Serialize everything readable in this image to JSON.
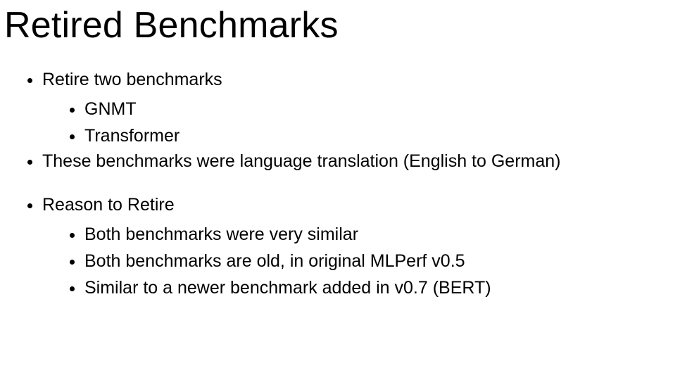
{
  "title": "Retired Benchmarks",
  "bullets": {
    "b1": "Retire two benchmarks",
    "b1_children": {
      "c1": "GNMT",
      "c2": "Transformer"
    },
    "b2": "These benchmarks were language translation (English to German)",
    "b3": "Reason to Retire",
    "b3_children": {
      "c1": "Both benchmarks were very similar",
      "c2": "Both benchmarks are old, in original MLPerf v0.5",
      "c3": "Similar to a newer benchmark added in v0.7 (BERT)"
    }
  }
}
